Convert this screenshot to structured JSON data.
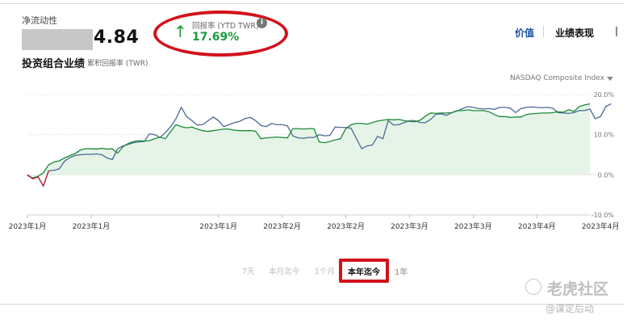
{
  "net_liquidity": {
    "label": "净流动性",
    "value_visible": "4.84"
  },
  "performance": {
    "title": "投资组合业绩",
    "subtitle": "累积回报率 (TWR)"
  },
  "return_box": {
    "label": "回报率 (YTD TWR)",
    "value": "17.69%",
    "arrow": "↑",
    "info_icon": "info-icon"
  },
  "tabs": [
    {
      "label": "价值"
    },
    {
      "label": "业绩表现"
    }
  ],
  "compare": {
    "label": "NASDAQ Composite Index"
  },
  "ranges": [
    "7天",
    "本月迄今",
    "1个月",
    "本年迄今",
    "1年"
  ],
  "selected_range": "本年迄今",
  "watermark": {
    "main": "老虎社区",
    "sub": "@谋定后动"
  },
  "colors": {
    "portfolio": "#1a8a35",
    "index": "#4a6896",
    "fill": "#e6f4e8",
    "accent": "#d2121c",
    "positive": "#1a9b3f"
  },
  "chart_data": {
    "type": "line",
    "y_ticks": [
      "20.0%",
      "10.0%",
      "0.0%",
      "-10.0%"
    ],
    "ylim": [
      -10,
      20
    ],
    "x_tick_labels": [
      "2023年1月",
      "2023年1月",
      "2023年1月",
      "2023年2月",
      "2023年2月",
      "2023年3月",
      "2023年3月",
      "2023年4月",
      "2023年4月"
    ],
    "x_tick_index": [
      0,
      12,
      36,
      48,
      60,
      72,
      84,
      96,
      108
    ],
    "series": [
      {
        "name": "portfolio",
        "values": [
          -0.2,
          -0.8,
          -0.4,
          0.5,
          2.5,
          3.2,
          3.5,
          4.2,
          4.8,
          5.3,
          6.2,
          6.5,
          6.5,
          6.4,
          6.6,
          6.4,
          6.5,
          5.4,
          7.0,
          7.8,
          8.3,
          8.5,
          8.4,
          8.5,
          9.0,
          9.4,
          9.0,
          10.8,
          12.5,
          12.0,
          11.7,
          11.9,
          11.4,
          11.0,
          10.8,
          11.0,
          11.2,
          11.4,
          11.4,
          11.1,
          11.0,
          11.0,
          11.0,
          10.9,
          9.0,
          9.2,
          9.3,
          9.4,
          9.3,
          9.2,
          11.5,
          11.5,
          11.4,
          11.5,
          11.5,
          8.2,
          8.0,
          8.3,
          8.7,
          9.0,
          11.5,
          12.5,
          12.8,
          12.8,
          12.6,
          13.0,
          13.4,
          13.6,
          13.8,
          13.7,
          13.8,
          13.5,
          13.3,
          13.2,
          13.6,
          14.6,
          15.4,
          15.3,
          15.4,
          15.4,
          15.5,
          16.0,
          16.0,
          16.2,
          16.0,
          16.0,
          16.0,
          15.7,
          15.0,
          14.5,
          14.5,
          14.3,
          14.4,
          14.4,
          15.0,
          15.2,
          15.3,
          15.4,
          15.4,
          15.5,
          15.7,
          15.6,
          16.2,
          15.8,
          17.0,
          17.4,
          17.69
        ]
      },
      {
        "name": "index",
        "values": [
          0,
          -1.0,
          -0.5,
          -2.8,
          1.0,
          1.1,
          1.5,
          3.4,
          4.3,
          4.8,
          5.0,
          5.1,
          5.1,
          5.2,
          5.0,
          4.2,
          3.8,
          6.5,
          7.2,
          7.6,
          8.0,
          8.2,
          8.3,
          10.2,
          10.0,
          9.3,
          10.5,
          12.0,
          14.0,
          16.8,
          14.5,
          13.5,
          12.4,
          12.5,
          13.4,
          14.4,
          13.5,
          12.0,
          12.5,
          13.0,
          13.3,
          14.0,
          14.3,
          13.5,
          12.3,
          12.0,
          12.8,
          12.5,
          12.5,
          12.2,
          9.7,
          9.2,
          9.1,
          9.3,
          9.3,
          10.0,
          9.7,
          9.8,
          11.9,
          11.8,
          11.8,
          11.6,
          9.0,
          6.5,
          7.2,
          7.4,
          9.6,
          9.0,
          13.5,
          12.4,
          12.5,
          13.0,
          13.5,
          13.5,
          13.0,
          13.0,
          13.8,
          15.1,
          15.2,
          14.8,
          15.5,
          15.9,
          16.5,
          17.0,
          16.8,
          16.5,
          16.4,
          16.5,
          16.3,
          16.8,
          16.8,
          16.6,
          15.5,
          16.5,
          16.8,
          16.9,
          16.8,
          16.7,
          16.8,
          16.6,
          15.5,
          15.4,
          15.3,
          15.5,
          16.0,
          16.0,
          16.4,
          14.0,
          14.5,
          17.0,
          17.69
        ]
      }
    ]
  }
}
